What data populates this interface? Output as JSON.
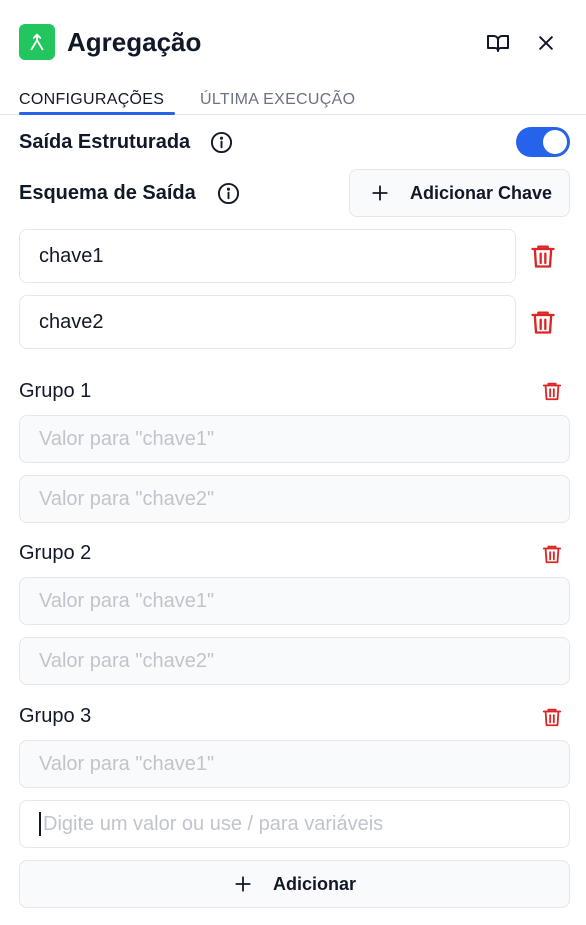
{
  "header": {
    "title": "Agregação",
    "app_icon": "merge-arrows-icon",
    "accent_color": "#22c55e"
  },
  "tabs": [
    {
      "label": "CONFIGURAÇÕES",
      "active": true
    },
    {
      "label": "ÚLTIMA EXECUÇÃO",
      "active": false
    }
  ],
  "structured_output": {
    "label": "Saída Estruturada",
    "enabled": true,
    "toggle_color": "#2563eb"
  },
  "schema": {
    "label": "Esquema de Saída",
    "add_key_label": "Adicionar Chave",
    "keys": [
      "chave1",
      "chave2"
    ]
  },
  "groups": [
    {
      "label": "Grupo 1",
      "fields": [
        "Valor para \"chave1\"",
        "Valor para \"chave2\""
      ]
    },
    {
      "label": "Grupo 2",
      "fields": [
        "Valor para \"chave1\"",
        "Valor para \"chave2\""
      ]
    },
    {
      "label": "Grupo 3",
      "fields": [
        "Valor para \"chave1\"",
        "Digite um valor ou use / para variáveis"
      ]
    }
  ],
  "add_button_label": "Adicionar",
  "danger_color": "#dc2626"
}
